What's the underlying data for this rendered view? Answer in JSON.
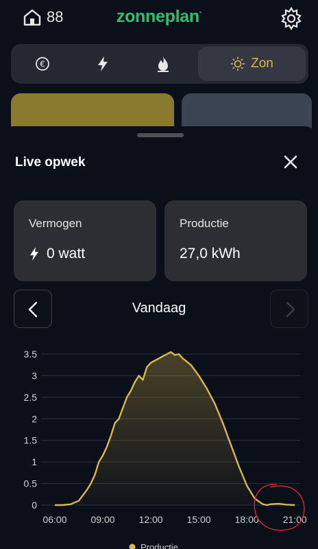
{
  "header": {
    "home_count": "88",
    "brand": "zonneplan",
    "brand_mark": "°"
  },
  "tabs": [
    {
      "icon": "euro-icon",
      "label": ""
    },
    {
      "icon": "bolt-icon",
      "label": ""
    },
    {
      "icon": "flame-icon",
      "label": ""
    },
    {
      "icon": "sun-icon",
      "label": "Zon",
      "active": true
    }
  ],
  "colors": {
    "brand": "#2fbf6d",
    "accent": "#d9b94e",
    "gold_card": "#8a7a2f",
    "blue_card": "#3b4452",
    "annotation": "#e0262b"
  },
  "sheet": {
    "title": "Live opwek",
    "cards": [
      {
        "label": "Vermogen",
        "value": "0 watt",
        "icon": "bolt-icon"
      },
      {
        "label": "Productie",
        "value": "27,0 kWh"
      }
    ],
    "period": "Vandaag"
  },
  "chart_data": {
    "type": "area",
    "series": [
      {
        "name": "Productie",
        "x": [
          "06:00",
          "06:30",
          "07:00",
          "07:30",
          "08:00",
          "08:15",
          "08:30",
          "08:45",
          "09:00",
          "09:15",
          "09:30",
          "09:45",
          "10:00",
          "10:15",
          "10:30",
          "10:45",
          "11:00",
          "11:15",
          "11:30",
          "11:45",
          "12:00",
          "12:15",
          "12:30",
          "12:45",
          "13:00",
          "13:15",
          "13:30",
          "13:45",
          "14:00",
          "14:30",
          "15:00",
          "15:30",
          "16:00",
          "16:30",
          "17:00",
          "17:30",
          "18:00",
          "18:30",
          "19:00",
          "19:15",
          "19:30",
          "20:00",
          "20:30",
          "21:00"
        ],
        "values": [
          0,
          0,
          0.02,
          0.1,
          0.35,
          0.5,
          0.7,
          1.0,
          1.15,
          1.35,
          1.6,
          1.9,
          2.0,
          2.25,
          2.5,
          2.65,
          2.85,
          3.0,
          2.9,
          3.2,
          3.3,
          3.35,
          3.4,
          3.45,
          3.5,
          3.55,
          3.48,
          3.5,
          3.4,
          3.25,
          3.0,
          2.7,
          2.35,
          1.9,
          1.4,
          0.9,
          0.45,
          0.15,
          0.02,
          0,
          0.02,
          0.03,
          0.01,
          0
        ]
      }
    ],
    "x_ticks": [
      "06:00",
      "09:00",
      "12:00",
      "15:00",
      "18:00",
      "21:00"
    ],
    "y_ticks": [
      "0",
      "0.5",
      "1",
      "1.5",
      "2",
      "2.5",
      "3",
      "3.5"
    ],
    "ylim": [
      0,
      3.5
    ],
    "grid": true,
    "legend": "bottom-center",
    "annotation": "red hand-drawn circle around 21:00"
  }
}
